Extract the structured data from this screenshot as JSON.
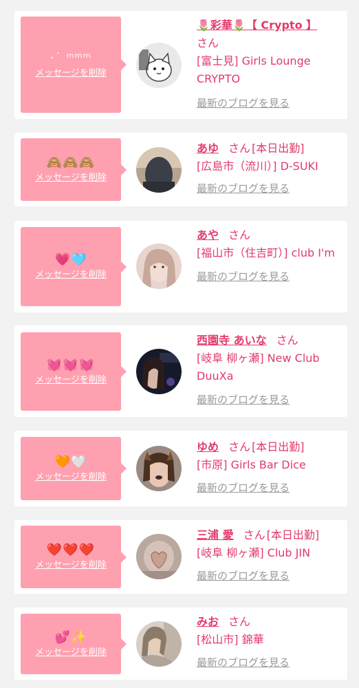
{
  "delete_label": "メッセージを削除",
  "blog_label": "最新のブログを見る",
  "honorific": "さん",
  "colors": {
    "background": "#f2f2f2",
    "card": "#ffffff",
    "bubble": "#ffa0b0",
    "accent": "#e23a6a",
    "muted": "#999999"
  },
  "entries": [
    {
      "message": "·˙ ᵐᵐᵐ",
      "name": "🌷彩華🌷【 Crypto 】",
      "tag": "",
      "shop": "[富士見] Girls Lounge CRYPTO",
      "avatar_icon": "cat-drawing-avatar"
    },
    {
      "message": "🙈🙈🙈",
      "name": "あゆ",
      "tag": "[本日出勤]",
      "shop": "[広島市（流川）] D-SUKI",
      "avatar_icon": "woman-photo-avatar"
    },
    {
      "message": "💗🩵",
      "name": "あや",
      "tag": "",
      "shop": "[福山市（住吉町）] club I'm",
      "avatar_icon": "woman-photo-avatar"
    },
    {
      "message": "💓💓💓",
      "name": "西園寺 あいな",
      "tag": "",
      "shop": "[岐阜 柳ヶ瀬] New Club DuuXa",
      "avatar_icon": "woman-photo-avatar"
    },
    {
      "message": "🧡🤍",
      "name": "ゆめ",
      "tag": "[本日出勤]",
      "shop": "[市原] Girls Bar Dice",
      "avatar_icon": "woman-photo-avatar"
    },
    {
      "message": "❤️❤️❤️",
      "name": "三浦 愛",
      "tag": "[本日出勤]",
      "shop": "[岐阜 柳ヶ瀬] Club JIN",
      "avatar_icon": "woman-photo-avatar"
    },
    {
      "message": "💕✨",
      "name": "みお",
      "tag": "",
      "shop": "[松山市] 錦華",
      "avatar_icon": "woman-photo-avatar"
    }
  ]
}
